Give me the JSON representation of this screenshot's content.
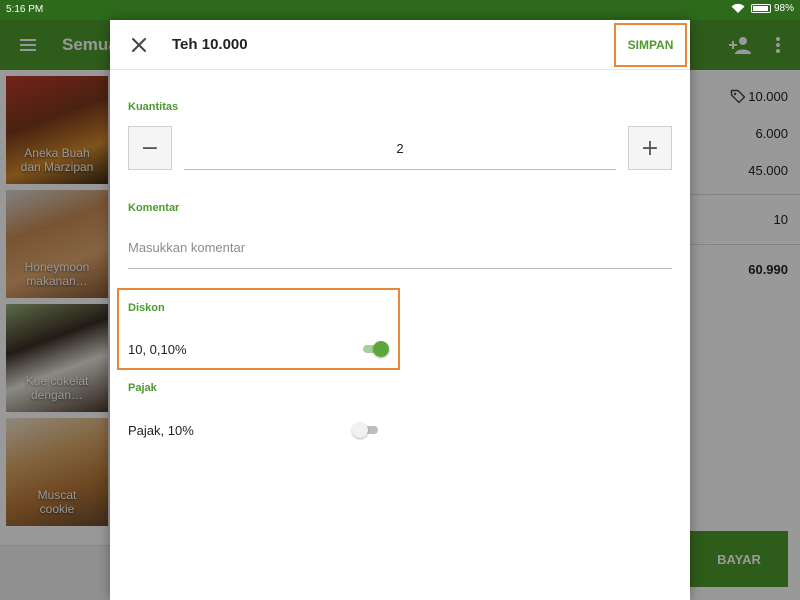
{
  "status_bar": {
    "time": "5:16 PM",
    "battery": "98%"
  },
  "appbar": {
    "title": "Semua"
  },
  "products": [
    {
      "name": "Aneka Buah dan Marzipan",
      "line1": "Aneka Buah",
      "line2": "dan Marzipan",
      "bg": "#6d3a28"
    },
    {
      "name": "Honeymoon makanan…",
      "line1": "Honeymoon",
      "line2": "makanan…",
      "bg": "#b8794b"
    },
    {
      "name": "Kue cokelat dengan…",
      "line1": "Kue cokelat",
      "line2": "dengan…",
      "bg": "#5a5a4a"
    },
    {
      "name": "Muscat cookie",
      "line1": "Muscat",
      "line2": "cookie",
      "bg": "#c89360"
    }
  ],
  "summary": {
    "price": "10.000",
    "line_a": "6.000",
    "line_b": "45.000",
    "line_c": "10",
    "total": "60.990"
  },
  "pay_button": "BAYAR",
  "dialog": {
    "title": "Teh 10.000",
    "save_label": "SIMPAN",
    "quantity": {
      "label": "Kuantitas",
      "value": "2",
      "minus": "−",
      "plus": "+"
    },
    "comment": {
      "label": "Komentar",
      "placeholder": "Masukkan komentar",
      "value": ""
    },
    "discount": {
      "label": "Diskon",
      "value": "10, 0,10%",
      "enabled": true
    },
    "tax": {
      "label": "Pajak",
      "value": "Pajak, 10%",
      "enabled": false
    }
  },
  "colors": {
    "brand_green": "#4d9a2e",
    "status_bar": "#2e6a1c",
    "highlight_orange": "#e8873a"
  },
  "icons": [
    "menu-icon",
    "add-person-icon",
    "more-vert-icon",
    "close-icon",
    "price-tag-icon",
    "wifi-icon",
    "battery-icon"
  ]
}
